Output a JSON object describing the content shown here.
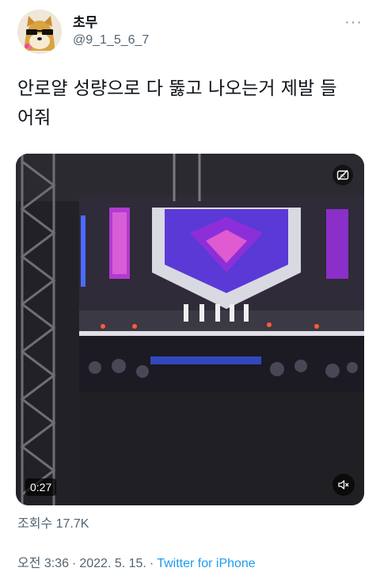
{
  "user": {
    "display_name": "초무",
    "handle": "@9_1_5_6_7",
    "avatar": "shiba-with-sunglasses-avatar"
  },
  "more_icon": "more-dots-icon",
  "tweet": {
    "line1": "안로얄 성량으로 다 뚫고 나오는거 제발 들",
    "line2": "어줘"
  },
  "media": {
    "type": "video",
    "duration": "0:27",
    "cc_icon": "captions-icon",
    "mute_icon": "speaker-muted-icon"
  },
  "stats": {
    "views": "조회수 17.7K"
  },
  "meta": {
    "time": "오전 3:36",
    "date": "2022. 5. 15.",
    "separator": "·",
    "source": "Twitter for iPhone"
  },
  "colors": {
    "link": "#1d9bf0",
    "secondary": "#536471",
    "text": "#0f1419"
  }
}
